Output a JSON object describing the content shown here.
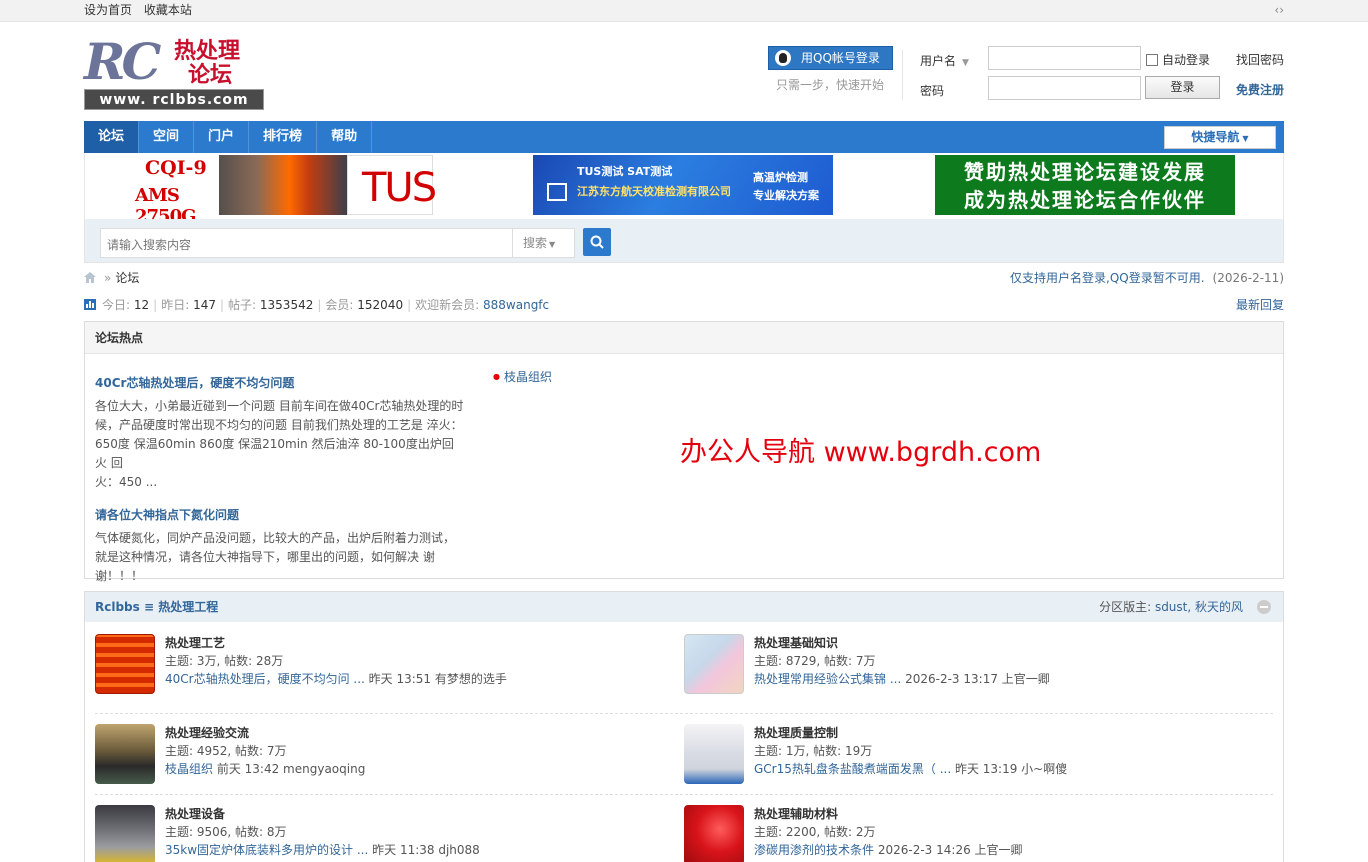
{
  "topbar": {
    "links": [
      "设为首页",
      "收藏本站"
    ],
    "arrows": "‹›"
  },
  "logo": {
    "rc": "RC",
    "cn_line1": "热处理",
    "cn_line2": "论坛",
    "url": "www. rclbbs.com"
  },
  "qq": {
    "button": "用QQ帐号登录",
    "sub": "只需一步，快速开始"
  },
  "login": {
    "username_label": "用户名",
    "password_label": "密码",
    "auto_login": "自动登录",
    "login_button": "登录",
    "find_password": "找回密码",
    "register": "免费注册"
  },
  "nav": {
    "items": [
      "论坛",
      "空间",
      "门户",
      "排行榜",
      "帮助"
    ],
    "quick": "快捷导航"
  },
  "ads": {
    "ad1": {
      "line1": "CQI-9",
      "line2": "AMS 2750G",
      "tus": "TUS"
    },
    "ad2": {
      "l1": "TUS测试  SAT测试",
      "l2": "江苏东方航天校准检测有限公司",
      "l3": "高温炉检测",
      "l4": "专业解决方案"
    },
    "ad3": {
      "l1": "赞助热处理论坛建设发展",
      "l2": "成为热处理论坛合作伙伴"
    }
  },
  "search": {
    "placeholder": "请输入搜索内容",
    "type": "搜索"
  },
  "breadcrumb": {
    "current": "论坛",
    "notice": "仅支持用户名登录,QQ登录暂不可用.",
    "notice_date": "(2026-2-11)"
  },
  "stats": {
    "today_label": "今日:",
    "today": "12",
    "yesterday_label": "昨日:",
    "yesterday": "147",
    "posts_label": "帖子:",
    "posts": "1353542",
    "members_label": "会员:",
    "members": "152040",
    "welcome_label": "欢迎新会员:",
    "newest": "888wangfc",
    "latest_reply": "最新回复"
  },
  "hot": {
    "title": "论坛热点",
    "topics": [
      {
        "title": "40Cr芯轴热处理后，硬度不均匀问题",
        "lines": [
          "各位大大，小弟最近碰到一个问题 目前车间在做40Cr芯轴热处理的时",
          "候，产品硬度时常出现不均匀的问题 目前我们热处理的工艺是 淬火：",
          "650度 保温60min 860度 保温210min 然后油淬 80-100度出炉回火 回",
          "火：450 ..."
        ]
      },
      {
        "title": "请各位大神指点下氮化问题",
        "lines": [
          "气体硬氮化，同炉产品没问题，比较大的产品，出炉后附着力测试，",
          "就是这种情况，请各位大神指导下，哪里出的问题，如何解决 谢",
          "谢！！！"
        ]
      }
    ],
    "side_link": "枝晶组织"
  },
  "watermark": "办公人导航  www.bgrdh.com",
  "group": {
    "title": "Rclbbs ≡ 热处理工程",
    "mod_label": "分区版主:",
    "mods": "sdust, 秋天的风",
    "forums": [
      {
        "name": "热处理工艺",
        "meta": "主题: 3万, 帖数: 28万",
        "last_link": "40Cr芯轴热处理后，硬度不均匀问 ...",
        "last_rest": "昨天 13:51 有梦想的选手"
      },
      {
        "name": "热处理基础知识",
        "meta": "主题: 8729, 帖数: 7万",
        "last_link": "热处理常用经验公式集锦 ...",
        "last_rest": "2026-2-3 13:17 上官一卿"
      },
      {
        "name": "热处理经验交流",
        "meta": "主题: 4952, 帖数: 7万",
        "last_link": "枝晶组织",
        "last_rest": "前天 13:42 mengyaoqing"
      },
      {
        "name": "热处理质量控制",
        "meta": "主题: 1万, 帖数: 19万",
        "last_link": "GCr15热轧盘条盐酸煮端面发黑（ ...",
        "last_rest": "昨天 13:19 小~啊傻"
      },
      {
        "name": "热处理设备",
        "meta": "主题: 9506, 帖数: 8万",
        "last_link": "35kw固定炉体底装料多用炉的设计 ...",
        "last_rest": "昨天 11:38 djh088"
      },
      {
        "name": "热处理辅助材料",
        "meta": "主题: 2200, 帖数: 2万",
        "last_link": "渗碳用渗剂的技术条件",
        "last_rest": "2026-2-3 14:26 上官一卿"
      }
    ]
  },
  "colors": {
    "nav_blue": "#2b7acd",
    "link_blue": "#336699",
    "watermark_red": "#e5000d",
    "ad_green": "#0e7a1e"
  }
}
